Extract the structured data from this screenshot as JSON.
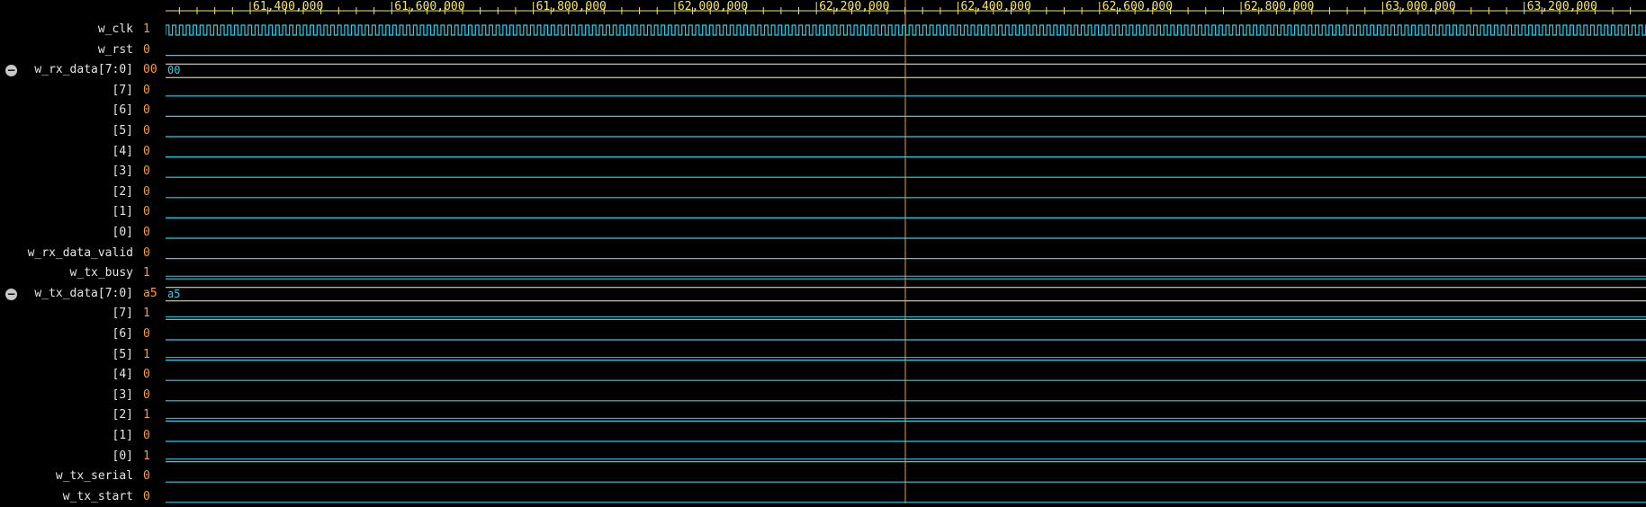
{
  "colors": {
    "background": "#000000",
    "signal_name": "#e6e6e6",
    "signal_value": "#ff9a2e",
    "waveform": "#22d3ee",
    "timeline": "#f5e663",
    "cursor": "#e8a23a",
    "bus_highlight": "#f5f0c8"
  },
  "timeline": {
    "labels": [
      "61,400,000",
      "61,600,000",
      "61,800,000",
      "62,000,000",
      "62,200,000",
      "62,400,000",
      "62,600,000",
      "62,800,000",
      "63,000,000",
      "63,200,000"
    ]
  },
  "signals": [
    {
      "name": "w_clk",
      "value": "1",
      "type": "clock"
    },
    {
      "name": "w_rst",
      "value": "0",
      "type": "low"
    },
    {
      "name": "w_rx_data[7:0]",
      "value": "00",
      "type": "bus",
      "bus_label": "00",
      "expanded": true
    },
    {
      "name": "[7]",
      "value": "0",
      "type": "low"
    },
    {
      "name": "[6]",
      "value": "0",
      "type": "low"
    },
    {
      "name": "[5]",
      "value": "0",
      "type": "low"
    },
    {
      "name": "[4]",
      "value": "0",
      "type": "low"
    },
    {
      "name": "[3]",
      "value": "0",
      "type": "low"
    },
    {
      "name": "[2]",
      "value": "0",
      "type": "low"
    },
    {
      "name": "[1]",
      "value": "0",
      "type": "low"
    },
    {
      "name": "[0]",
      "value": "0",
      "type": "low"
    },
    {
      "name": "w_rx_data_valid",
      "value": "0",
      "type": "low"
    },
    {
      "name": "w_tx_busy",
      "value": "1",
      "type": "high"
    },
    {
      "name": "w_tx_data[7:0]",
      "value": "a5",
      "type": "bus",
      "bus_label": "a5",
      "expanded": true
    },
    {
      "name": "[7]",
      "value": "1",
      "type": "high"
    },
    {
      "name": "[6]",
      "value": "0",
      "type": "low"
    },
    {
      "name": "[5]",
      "value": "1",
      "type": "high"
    },
    {
      "name": "[4]",
      "value": "0",
      "type": "low"
    },
    {
      "name": "[3]",
      "value": "0",
      "type": "low"
    },
    {
      "name": "[2]",
      "value": "1",
      "type": "high"
    },
    {
      "name": "[1]",
      "value": "0",
      "type": "low"
    },
    {
      "name": "[0]",
      "value": "1",
      "type": "high"
    },
    {
      "name": "w_tx_serial",
      "value": "0",
      "type": "low"
    },
    {
      "name": "w_tx_start",
      "value": "0",
      "type": "low"
    }
  ],
  "icons": {
    "collapse": "minus-circle-icon"
  }
}
